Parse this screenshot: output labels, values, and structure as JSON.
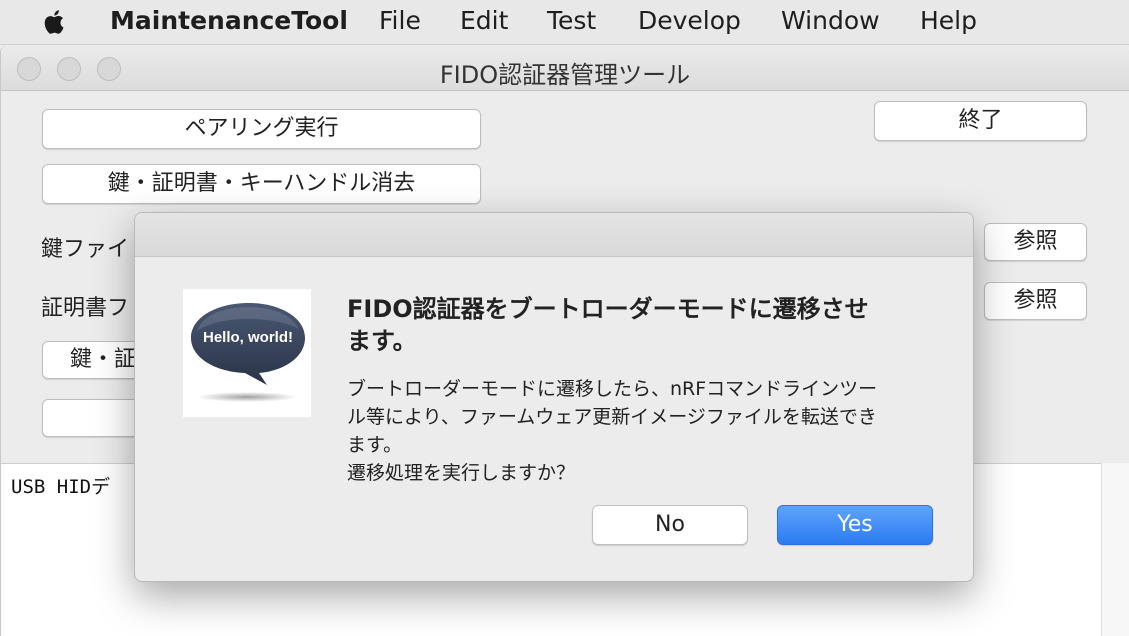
{
  "menubar": {
    "apple_icon": "apple-logo-icon",
    "app_name": "MaintenanceTool",
    "items": [
      "File",
      "Edit",
      "Test",
      "Develop",
      "Window",
      "Help"
    ]
  },
  "window": {
    "title": "FIDO認証器管理ツール",
    "buttons": {
      "pairing": "ペアリング実行",
      "erase": "鍵・証明書・キーハンドル消去",
      "quit": "終了",
      "browse_key": "参照",
      "browse_cert": "参照",
      "install_partial": "鍵・証"
    },
    "labels": {
      "key_file": "鍵ファイ",
      "cert_file": "証明書フ"
    },
    "log_text": "USB HIDデ"
  },
  "dialog": {
    "icon": "hello-world-speech-bubble-icon",
    "icon_text": "Hello, world!",
    "title_lines": [
      "FIDO認証器をブートローダーモードに遷移させ",
      "ます。"
    ],
    "message_lines": [
      "ブートローダーモードに遷移したら、nRFコマンドラインツー",
      "ル等により、ファームウェア更新イメージファイルを転送でき",
      "ます。",
      "遷移処理を実行しますか？"
    ],
    "no_label": "No",
    "yes_label": "Yes"
  },
  "colors": {
    "accent": "#2c7bf2",
    "window_bg": "#ececec"
  }
}
